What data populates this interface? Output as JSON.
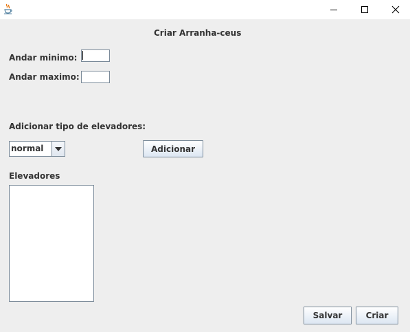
{
  "window": {
    "icon": "java-cup-icon",
    "controls": [
      "minimize-icon",
      "maximize-icon",
      "close-icon"
    ]
  },
  "form": {
    "title": "Criar Arranha-ceus",
    "min_floor_label": "Andar minimo:",
    "min_floor_value": "",
    "max_floor_label": "Andar maximo:",
    "max_floor_value": "",
    "add_type_label": "Adicionar tipo de elevadores:",
    "elevator_type_selected": "normal",
    "add_button": "Adicionar",
    "elevators_label": "Elevadores",
    "elevators": [],
    "save_button": "Salvar",
    "create_button": "Criar"
  }
}
